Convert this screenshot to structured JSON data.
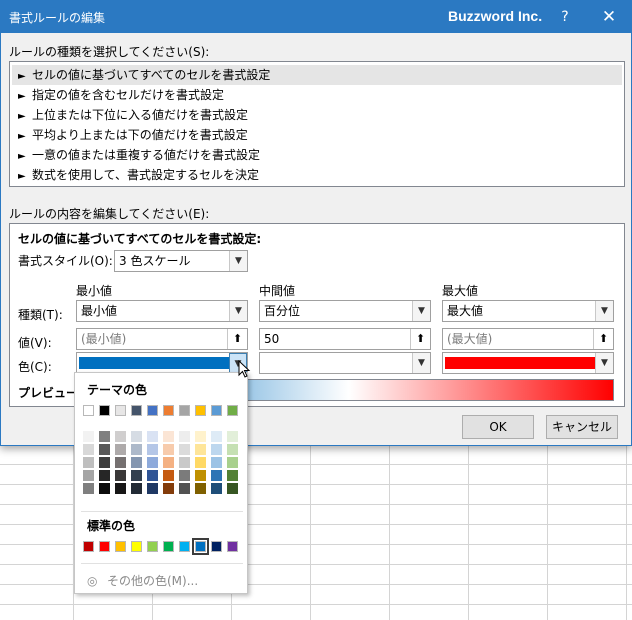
{
  "dialog": {
    "title": "書式ルールの編集",
    "brand": "Buzzword Inc.",
    "help": "?",
    "close": "✕"
  },
  "rule_type": {
    "label": "ルールの種類を選択してください(S):",
    "items": [
      "セルの値に基づいてすべてのセルを書式設定",
      "指定の値を含むセルだけを書式設定",
      "上位または下位に入る値だけを書式設定",
      "平均より上または下の値だけを書式設定",
      "一意の値または重複する値だけを書式設定",
      "数式を使用して、書式設定するセルを決定"
    ],
    "selected_index": 0
  },
  "edit": {
    "label": "ルールの内容を編集してください(E):",
    "heading": "セルの値に基づいてすべてのセルを書式設定:",
    "format_style_label": "書式スタイル(O):",
    "format_style_value": "3 色スケール",
    "col_min": "最小値",
    "col_mid": "中間値",
    "col_max": "最大値",
    "type_label": "種類(T):",
    "value_label": "値(V):",
    "color_label": "色(C):",
    "min_type": "最小値",
    "mid_type": "百分位",
    "max_type": "最大値",
    "min_value_placeholder": "(最小値)",
    "mid_value": "50",
    "max_value_placeholder": "(最大値)",
    "min_color": "#0070c0",
    "mid_color": "#ffffff",
    "max_color": "#ff0000",
    "preview_label": "プレビュー:"
  },
  "buttons": {
    "ok": "OK",
    "cancel": "キャンセル"
  },
  "color_panel": {
    "theme_heading": "テーマの色",
    "theme_colors": [
      "#ffffff",
      "#000000",
      "#e7e6e6",
      "#44546a",
      "#4472c4",
      "#ed7d31",
      "#a5a5a5",
      "#ffc000",
      "#5b9bd5",
      "#70ad47"
    ],
    "theme_shades": [
      [
        "#f2f2f2",
        "#808080",
        "#d0cece",
        "#d6dce4",
        "#d9e2f3",
        "#fbe5d5",
        "#ededed",
        "#fff2cc",
        "#deebf6",
        "#e2efd9"
      ],
      [
        "#d8d8d8",
        "#595959",
        "#aeaaaa",
        "#adb9ca",
        "#b4c6e7",
        "#f7cbac",
        "#dbdbdb",
        "#fee599",
        "#bdd7ee",
        "#c5e0b3"
      ],
      [
        "#bfbfbf",
        "#3f3f3f",
        "#757070",
        "#8496b0",
        "#8eaadb",
        "#f4b183",
        "#c9c9c9",
        "#ffd965",
        "#9cc3e5",
        "#a8d08d"
      ],
      [
        "#a5a5a5",
        "#262626",
        "#3a3838",
        "#323f4f",
        "#2f5496",
        "#c55a11",
        "#7b7b7b",
        "#bf9000",
        "#2e75b5",
        "#538135"
      ],
      [
        "#7f7f7f",
        "#0c0c0c",
        "#171616",
        "#222a35",
        "#1f3864",
        "#833c0b",
        "#525252",
        "#7f6000",
        "#1e4e79",
        "#375623"
      ]
    ],
    "standard_heading": "標準の色",
    "standard_colors": [
      "#c00000",
      "#ff0000",
      "#ffc000",
      "#ffff00",
      "#92d050",
      "#00b050",
      "#00b0f0",
      "#0070c0",
      "#002060",
      "#7030a0"
    ],
    "selected_standard_index": 7,
    "more_colors": "その他の色(M)..."
  }
}
